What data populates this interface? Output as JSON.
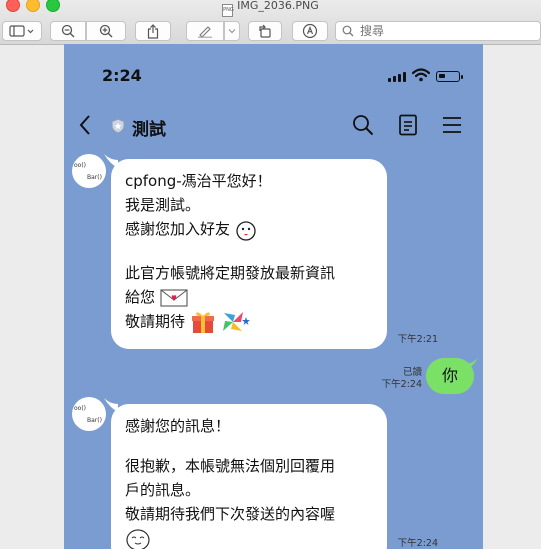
{
  "window": {
    "filename": "IMG_2036.PNG",
    "search_placeholder": "搜尋"
  },
  "phone": {
    "time": "2:24",
    "chat_title": "測試",
    "avatar_text_1": "oo()",
    "avatar_text_2": "Bar()"
  },
  "messages": [
    {
      "side": "in",
      "lines": [
        "cpfong-馮治平您好！",
        "我是測試。",
        "感謝您加入好友"
      ],
      "lines2": [
        "此官方帳號將定期發放最新資訊",
        "給您"
      ],
      "lines3": [
        "敬請期待"
      ],
      "time": "下午2:21"
    },
    {
      "side": "out",
      "text": "你",
      "read": "已讀",
      "time": "下午2:24"
    },
    {
      "side": "in",
      "line1": "感謝您的訊息！",
      "line2": "很抱歉，本帳號無法個別回覆用",
      "line3": "戶的訊息。",
      "line4": "敬請期待我們下次發送的內容喔",
      "time": "下午2:24"
    }
  ],
  "colors": {
    "chat_bg": "#7b9cd1",
    "my_bubble": "#7be166",
    "their_bubble": "#ffffff"
  }
}
